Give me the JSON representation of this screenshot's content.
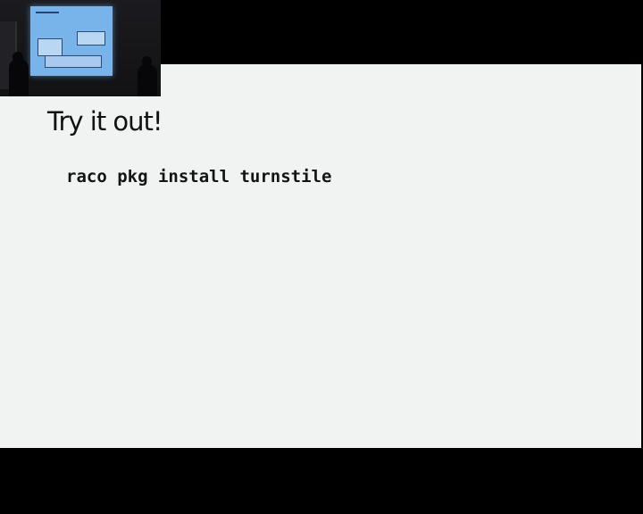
{
  "slide": {
    "title": "Try it out!",
    "code": "raco pkg install turnstile"
  },
  "video_inset": {
    "description_icon": "presenter-camera-icon"
  },
  "colors": {
    "slide_background": "#f1f2f2",
    "frame_background": "#000000",
    "text": "#111111",
    "projector_screen": "#78b4ea"
  }
}
